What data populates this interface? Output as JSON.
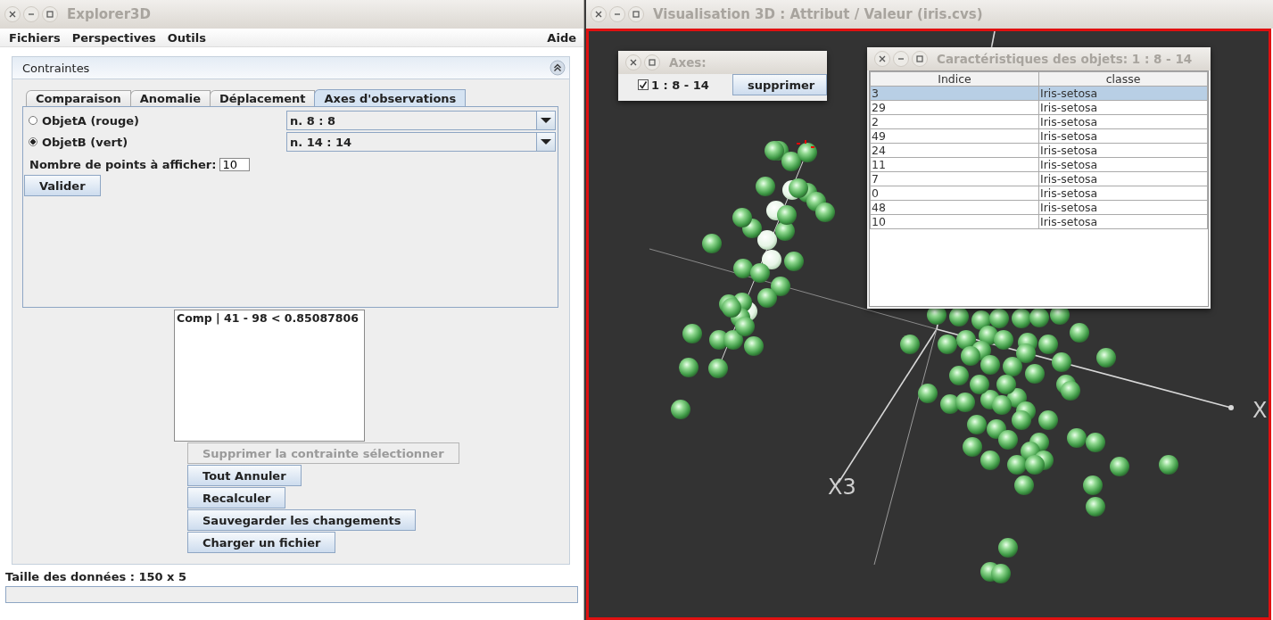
{
  "main_window": {
    "title": "Explorer3D",
    "menu": [
      "Fichiers",
      "Perspectives",
      "Outils"
    ],
    "help_menu": "Aide",
    "panel": {
      "title": "Contraintes",
      "tabs": [
        {
          "label": "Comparaison",
          "selected": false
        },
        {
          "label": "Anomalie",
          "selected": false
        },
        {
          "label": "Déplacement",
          "selected": false
        },
        {
          "label": "Axes d'observations",
          "selected": true
        }
      ],
      "objects": [
        {
          "label": "ObjetA (rouge)",
          "selected": false,
          "value": "n. 8 : 8"
        },
        {
          "label": "ObjetB (vert)",
          "selected": true,
          "value": "n. 14 : 14"
        }
      ],
      "points_label": "Nombre de points à afficher:",
      "points_value": "10",
      "validate_button": "Valider",
      "constraints": [
        "Comp | 41 - 98 < 0.85087806"
      ],
      "buttons": [
        {
          "label": "Supprimer la contrainte sélectionner",
          "disabled": true
        },
        {
          "label": "Tout Annuler",
          "disabled": false
        },
        {
          "label": "Recalculer",
          "disabled": false
        },
        {
          "label": "Sauvegarder les changements",
          "disabled": false
        },
        {
          "label": "Charger un fichier",
          "disabled": false
        }
      ]
    },
    "status": "Taille des données : 150 x 5",
    "progress": {
      "level": 0
    }
  },
  "viewer_window": {
    "title": "Visualisation 3D : Attribut / Valeur (iris.cvs)",
    "axis_labels": [
      "X3",
      "X"
    ],
    "axes_dialog": {
      "title": "Axes:",
      "items": [
        {
          "label": "1 : 8 - 14",
          "checked": true
        }
      ],
      "delete_button": "supprimer"
    },
    "objects_dialog": {
      "title": "Caractéristiques des objets: 1 : 8 - 14",
      "columns": [
        "Indice",
        "classe"
      ],
      "rows": [
        {
          "cells": [
            "3",
            "Iris-setosa"
          ],
          "selected": true
        },
        {
          "cells": [
            "29",
            "Iris-setosa"
          ],
          "selected": false
        },
        {
          "cells": [
            "2",
            "Iris-setosa"
          ],
          "selected": false
        },
        {
          "cells": [
            "49",
            "Iris-setosa"
          ],
          "selected": false
        },
        {
          "cells": [
            "24",
            "Iris-setosa"
          ],
          "selected": false
        },
        {
          "cells": [
            "11",
            "Iris-setosa"
          ],
          "selected": false
        },
        {
          "cells": [
            "7",
            "Iris-setosa"
          ],
          "selected": false
        },
        {
          "cells": [
            "0",
            "Iris-setosa"
          ],
          "selected": false
        },
        {
          "cells": [
            "48",
            "Iris-setosa"
          ],
          "selected": false
        },
        {
          "cells": [
            "10",
            "Iris-setosa"
          ],
          "selected": false
        }
      ]
    }
  }
}
